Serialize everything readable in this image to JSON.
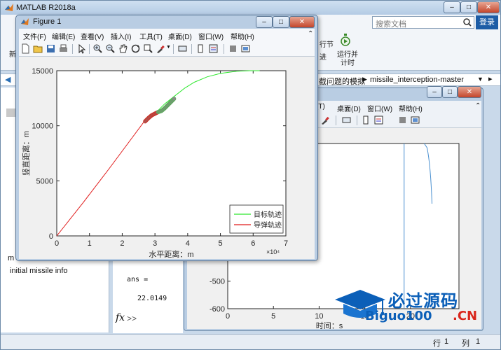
{
  "matlab": {
    "title": "MATLAB R2018a",
    "search_placeholder": "搜索文档",
    "login": "登录",
    "ribbon": {
      "run_section": "行节",
      "advance": "进",
      "run_advance": "运行并",
      "time": "计时",
      "new_partial": "新"
    },
    "path": {
      "segment1": "截问题的模拟",
      "segment2": "missile_interception-master"
    },
    "detail_text": "initial missile info",
    "cmd_m": "m",
    "cmd": {
      "ans": "ans =",
      "value": "22.0149",
      "fx": "fx",
      "prompt": ">>"
    },
    "status": {
      "row_label": "行",
      "row": "1",
      "col_label": "列",
      "col": "1"
    }
  },
  "figure1": {
    "title": "Figure 1",
    "menu": [
      "文件(F)",
      "编辑(E)",
      "查看(V)",
      "插入(I)",
      "工具(T)",
      "桌面(D)",
      "窗口(W)",
      "帮助(H)"
    ]
  },
  "figure2": {
    "menu": [
      "(T)",
      "桌面(D)",
      "窗口(W)",
      "帮助(H)"
    ]
  },
  "chart_data": [
    {
      "type": "line",
      "xlabel": "水平距离：m",
      "ylabel": "竖直距离：m",
      "x_exponent_label": "×10⁴",
      "xlim": [
        0,
        7
      ],
      "ylim": [
        0,
        15000
      ],
      "xticks": [
        0,
        1,
        2,
        3,
        4,
        5,
        6,
        7
      ],
      "yticks": [
        0,
        5000,
        10000,
        15000
      ],
      "legend": {
        "placement": "bottom-right",
        "entries": [
          "目标轨迹",
          "导弹轨迹"
        ]
      },
      "colors": {
        "target": "#2ee82e",
        "missile": "#e01b1b",
        "marker": "#8a8a8a"
      },
      "series": [
        {
          "name": "目标轨迹",
          "x": [
            3.1,
            3.3,
            3.6,
            3.9,
            4.2,
            4.6,
            5.0,
            5.5,
            5.9,
            6.2
          ],
          "y": [
            11400,
            12000,
            12700,
            13400,
            13950,
            14450,
            14750,
            14950,
            15000,
            15000
          ]
        },
        {
          "name": "导弹轨迹",
          "x": [
            0,
            0.8,
            1.6,
            2.3,
            2.7,
            2.9,
            3.1
          ],
          "y": [
            0,
            3000,
            6100,
            8900,
            10500,
            11100,
            11400
          ]
        },
        {
          "x": [
            2.7,
            2.8,
            2.9,
            3.0,
            3.1,
            3.2,
            3.3,
            3.4,
            3.5,
            3.6
          ],
          "y": [
            10400,
            10700,
            10950,
            11100,
            11250,
            11350,
            11600,
            11900,
            12200,
            12500
          ]
        }
      ]
    },
    {
      "type": "line",
      "xlabel": "时间：s",
      "ylim": [
        -600,
        0
      ],
      "yticks": [
        -500,
        -600
      ],
      "xticks": [
        0,
        5,
        10,
        15,
        20
      ],
      "colors": {
        "line": "#4a90d0"
      },
      "series": [
        {
          "x": [
            19.3,
            19.3,
            19.6,
            20.2,
            20.9,
            21.4,
            21.5,
            21.5
          ],
          "y": [
            -590,
            0,
            0,
            0,
            0,
            0,
            0,
            0
          ]
        },
        {
          "x": [
            21.5,
            21.8,
            22.1,
            22.3,
            22.35
          ],
          "y": [
            0,
            0,
            0,
            0,
            0
          ]
        }
      ]
    }
  ]
}
